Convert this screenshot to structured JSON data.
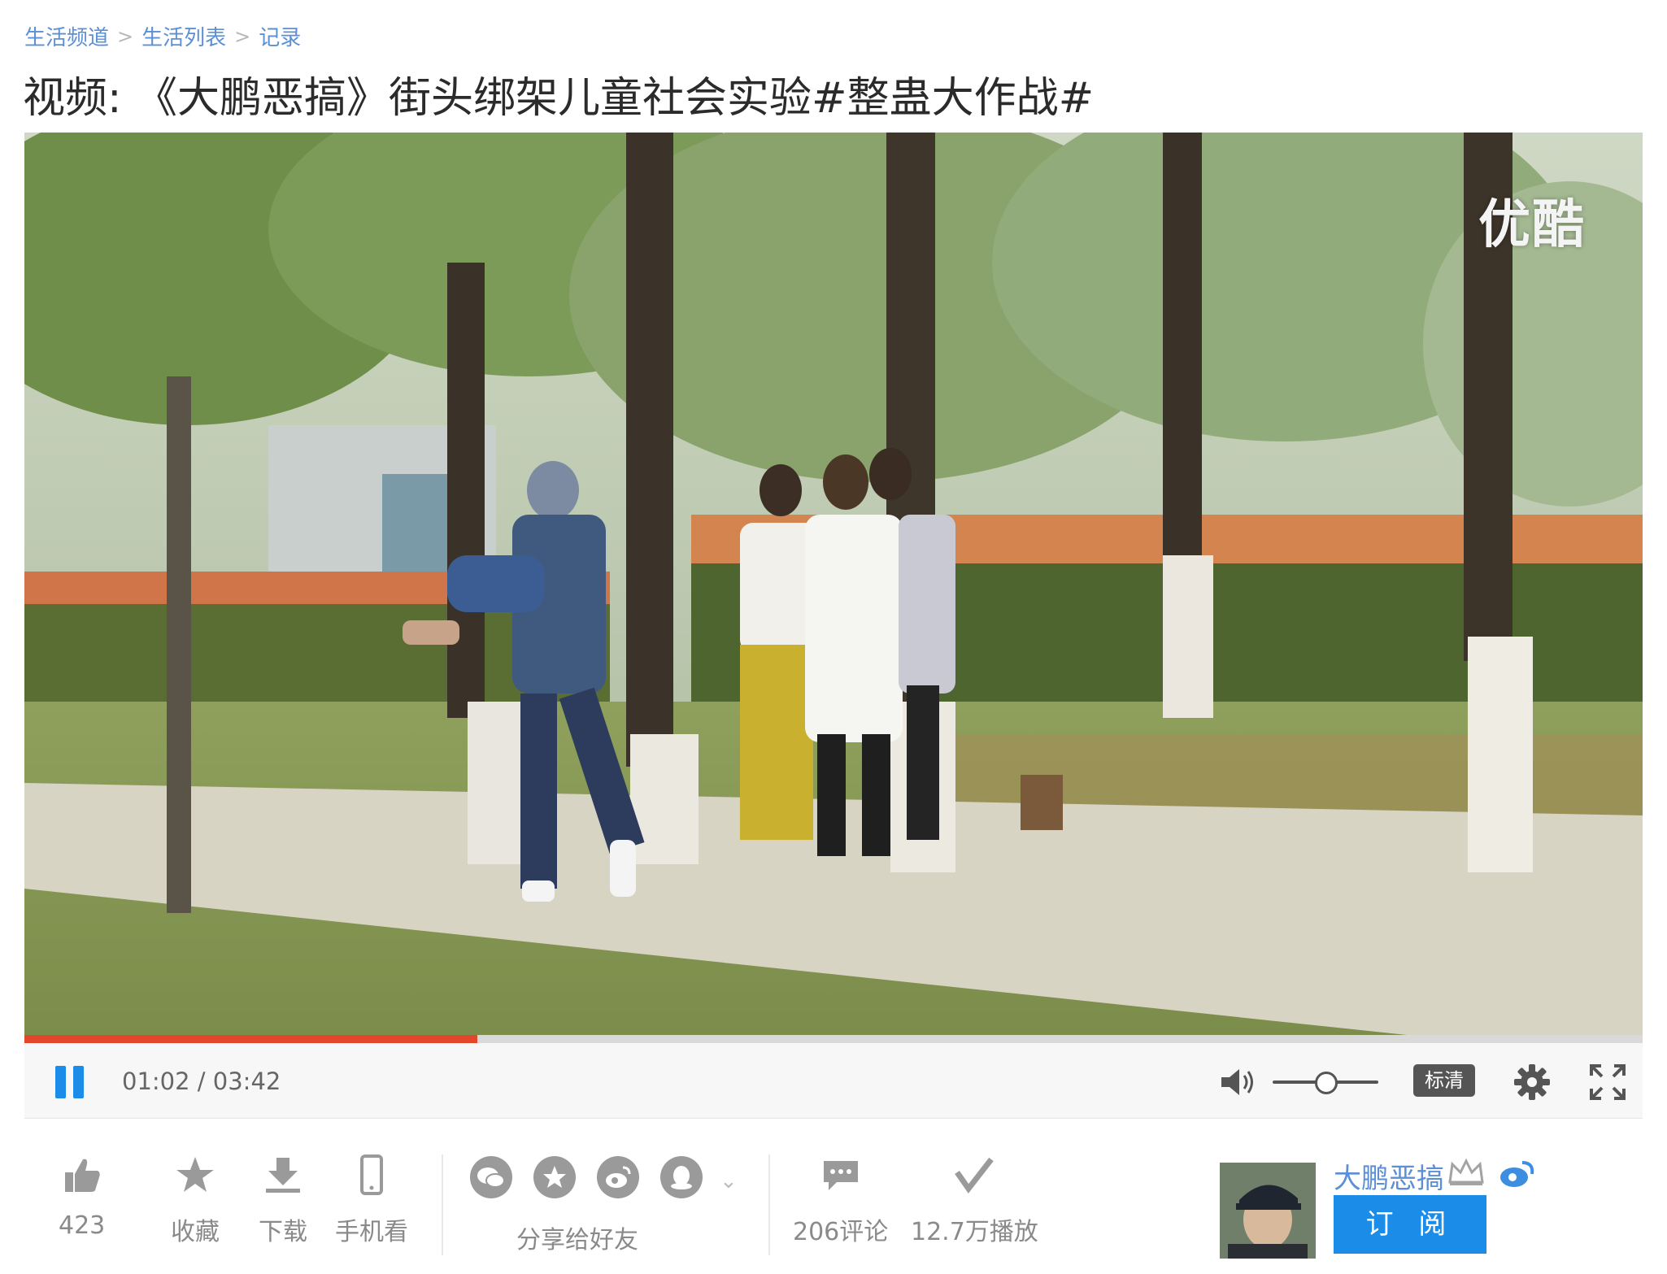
{
  "breadcrumb": {
    "items": [
      "生活频道",
      "生活列表",
      "记录"
    ],
    "separator": ">"
  },
  "page_title": "视频: 《大鹏恶搞》街头绑架儿童社会实验#整蛊大作战#",
  "player": {
    "watermark": "优酷",
    "current_time": "01:02",
    "duration": "03:42",
    "time_display": "01:02 / 03:42",
    "progress_fraction": 0.28,
    "volume_fraction": 0.5,
    "quality_label": "标清",
    "state": "playing",
    "accent_color": "#1b8de8",
    "progress_color": "#e4462c"
  },
  "actions": {
    "like_count": "423",
    "favorite_label": "收藏",
    "download_label": "下载",
    "mobile_label": "手机看",
    "share_label": "分享给好友",
    "comments_label": "206评论",
    "plays_label": "12.7万播放"
  },
  "share_icons": [
    "wechat-icon",
    "qzone-icon",
    "weibo-icon",
    "qq-icon"
  ],
  "channel": {
    "name": "大鹏恶搞",
    "subscribe_label": "订 阅"
  }
}
